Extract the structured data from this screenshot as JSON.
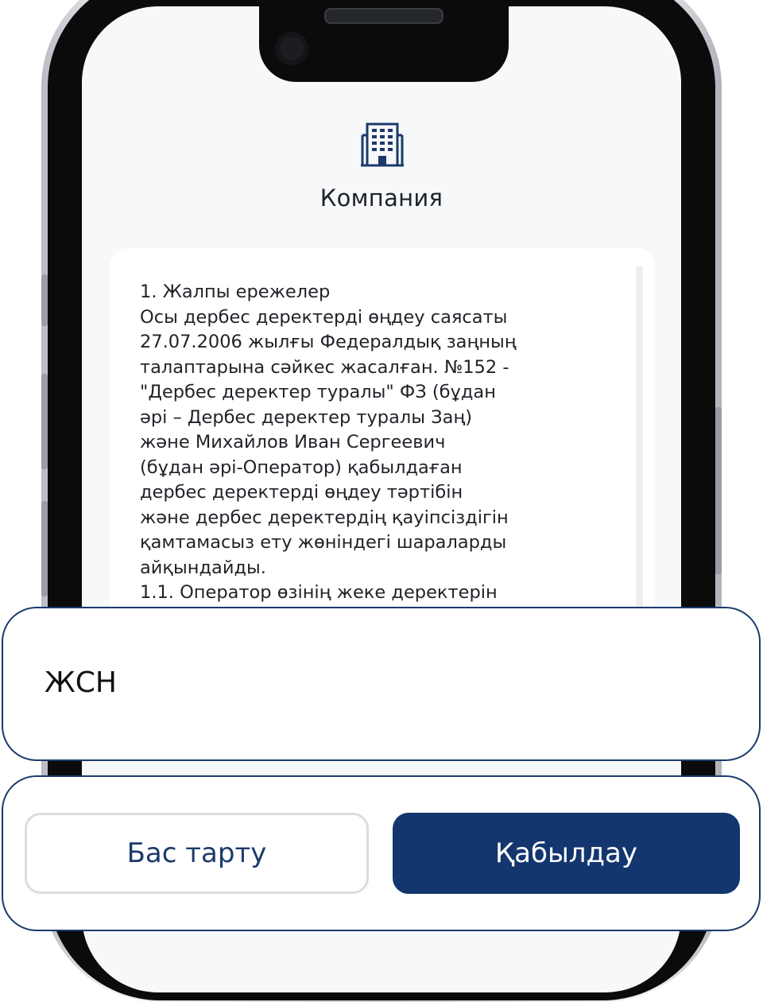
{
  "header": {
    "icon": "office-building-icon",
    "title": "Компания"
  },
  "policy": {
    "text": "1. Жалпы ережелер\nОсы дербес деректерді өңдеу саясаты\n27.07.2006 жылғы Федералдық заңның\nталаптарына сәйкес жасалған. №152 -\n\"Дербес деректер туралы\" ФЗ (бұдан\nәрі – Дербес деректер туралы Заң)\nжәне Михайлов Иван Сергеевич\n(бұдан әрі-Оператор) қабылдаған\nдербес деректерді өңдеу тәртібін\nжәне дербес деректердің қауіпсіздігін\nқамтамасыз ету жөніндегі шараларды\nайқындайды.\n1.1. Оператор өзінің жеке деректерін"
  },
  "field": {
    "label": "ЖСН"
  },
  "actions": {
    "cancel_label": "Бас тарту",
    "accept_label": "Қабылдау"
  },
  "colors": {
    "primary": "#14366e",
    "panel_border": "#1b3a6b",
    "screen_bg": "#f7f8fa",
    "icon": "#1b3a6b"
  }
}
